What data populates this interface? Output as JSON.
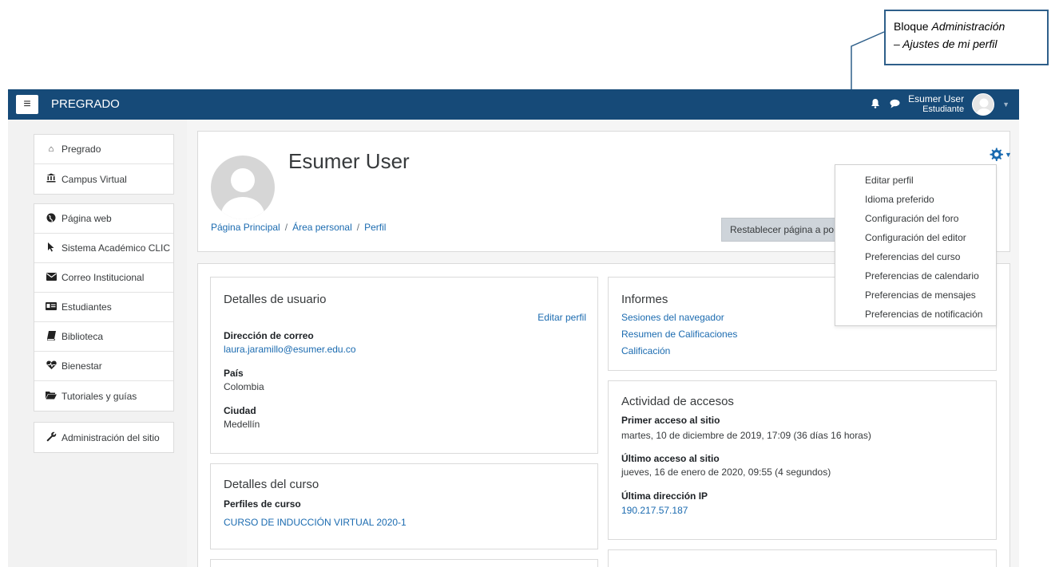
{
  "callout": {
    "line1_normal": "Bloque ",
    "line1_italic": "Administración",
    "line2": "– Ajustes de mi perfil"
  },
  "navbar": {
    "brand": "PREGRADO",
    "menu_icon": "hamburger-icon",
    "user_name": "Esumer User",
    "user_role": "Estudiante",
    "bg_color": "#164a78"
  },
  "sidebar": {
    "group1": [
      {
        "label": "Pregrado",
        "icon": "home-icon"
      },
      {
        "label": "Campus Virtual",
        "icon": "university-icon"
      }
    ],
    "group2": [
      {
        "label": "Página web",
        "icon": "globe-icon"
      },
      {
        "label": "Sistema Académico CLIC",
        "icon": "pointer-icon"
      },
      {
        "label": "Correo Institucional",
        "icon": "envelope-icon"
      },
      {
        "label": "Estudiantes",
        "icon": "id-card-icon"
      },
      {
        "label": "Biblioteca",
        "icon": "book-icon"
      },
      {
        "label": "Bienestar",
        "icon": "heartbeat-icon"
      },
      {
        "label": "Tutoriales y guías",
        "icon": "folder-open-icon"
      }
    ],
    "group3": [
      {
        "label": "Administración del sitio",
        "icon": "wrench-icon"
      }
    ]
  },
  "header": {
    "profile_name": "Esumer User",
    "breadcrumb": [
      "Página Principal",
      "Área personal",
      "Perfil"
    ],
    "reset_button": "Restablecer página a por"
  },
  "admin_menu": {
    "items": [
      "Editar perfil",
      "Idioma preferido",
      "Configuración del foro",
      "Configuración del editor",
      "Preferencias del curso",
      "Preferencias de calendario",
      "Preferencias de mensajes",
      "Preferencias de notificación"
    ]
  },
  "user_details": {
    "title": "Detalles de usuario",
    "edit_link": "Editar perfil",
    "email_label": "Dirección de correo",
    "email_value": "laura.jaramillo@esumer.edu.co",
    "country_label": "País",
    "country_value": "Colombia",
    "city_label": "Ciudad",
    "city_value": "Medellín"
  },
  "reports": {
    "title": "Informes",
    "links": [
      "Sesiones del navegador",
      "Resumen de Calificaciones",
      "Calificación"
    ]
  },
  "course_details": {
    "title": "Detalles del curso",
    "profiles_label": "Perfiles de curso",
    "course_link": "CURSO DE INDUCCIÓN VIRTUAL 2020-1"
  },
  "access": {
    "title": "Actividad de accesos",
    "first_label": "Primer acceso al sitio",
    "first_value": "martes, 10 de diciembre de 2019, 17:09  (36 días 16 horas)",
    "last_label": "Último acceso al sitio",
    "last_value": "jueves, 16 de enero de 2020, 09:55  (4 segundos)",
    "ip_label": "Última dirección IP",
    "ip_value": "190.217.57.187"
  }
}
